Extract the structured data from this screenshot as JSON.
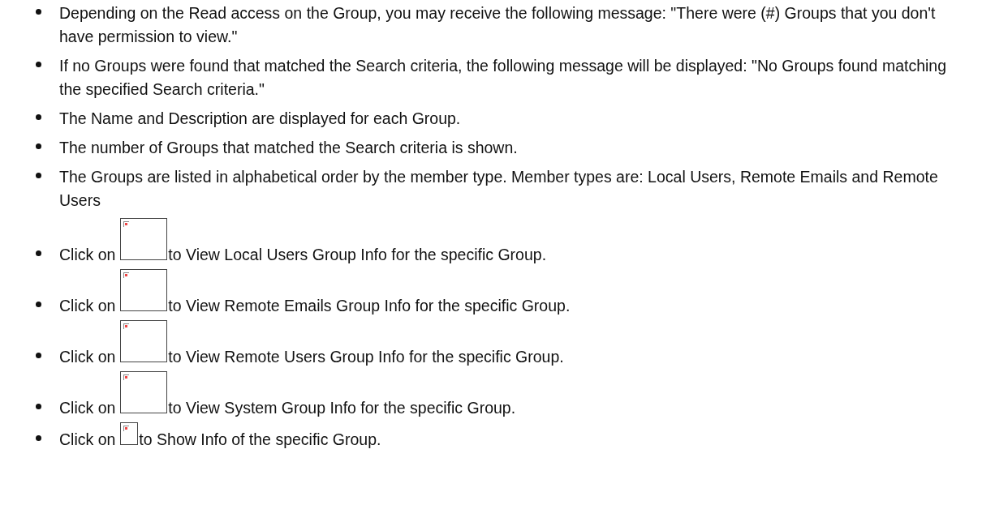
{
  "bullets": [
    {
      "kind": "text",
      "text": "Depending on the Read access on the Group, you may receive the following message: \"There were (#) Groups that you don't have permission to view.\""
    },
    {
      "kind": "text",
      "text": "If no Groups were found that matched the Search criteria, the following message will be displayed: \"No Groups found matching the specified Search criteria.\""
    },
    {
      "kind": "text",
      "text": "The Name and Description are displayed for each Group."
    },
    {
      "kind": "text",
      "text": "The number of Groups that matched the Search criteria is shown."
    },
    {
      "kind": "text",
      "text": "The Groups are listed in alphabetical order by the member type. Member types are: Local Users, Remote Emails and Remote Users"
    },
    {
      "kind": "wide-image",
      "before": "Click on",
      "after": "to View Local Users Group Info for the specific Group."
    },
    {
      "kind": "wide-image",
      "before": "Click on",
      "after": "to View Remote Emails Group Info for the specific Group."
    },
    {
      "kind": "wide-image",
      "before": "Click on",
      "after": "to View Remote Users Group Info for the specific Group."
    },
    {
      "kind": "wide-image",
      "before": "Click on",
      "after": "to View System Group Info for the specific Group."
    },
    {
      "kind": "small-image",
      "before": "Click on",
      "after": "to Show Info of the specific Group."
    }
  ]
}
